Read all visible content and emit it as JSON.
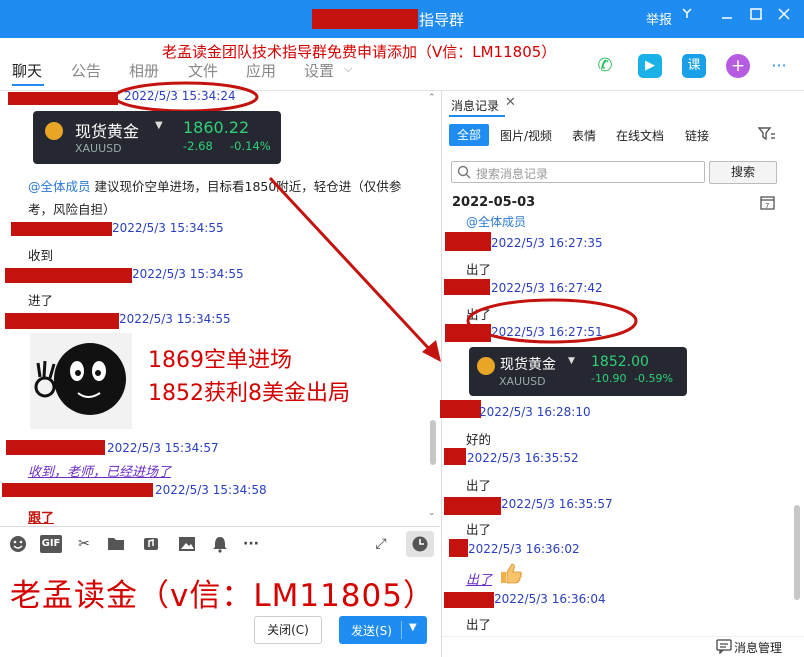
{
  "window": {
    "title": "指导群",
    "report": "举报",
    "promo_banner": "老孟读金团队技术指导群免费申请添加（V信：LM11805）"
  },
  "nav": {
    "tabs": [
      "聊天",
      "公告",
      "相册",
      "文件",
      "应用",
      "设置"
    ]
  },
  "top_icons": {
    "phone": "phone-icon",
    "video": "video-icon",
    "course_label": "课",
    "add": "+",
    "more": "···"
  },
  "chat": {
    "messages": [
      {
        "time": "2022/5/3 15:34:24"
      },
      {
        "time": "2022/5/3 15:34:55",
        "text": "收到"
      },
      {
        "time": "2022/5/3 15:34:55",
        "text": "进了"
      },
      {
        "time": "2022/5/3 15:34:55"
      },
      {
        "time": "2022/5/3 15:34:57",
        "text": "收到，老师，已经进场了"
      },
      {
        "time": "2022/5/3 15:34:58",
        "text": "跟了"
      }
    ],
    "mention": "@全体成员",
    "announcement_line1": "建议现价空单进场，目标看1850附近，轻仓进（仅供参",
    "announcement_line2": "考，风险自担）",
    "gold_card": {
      "name": "现货黄金",
      "symbol": "XAUUSD",
      "price": "1860.22",
      "change": "-2.68",
      "pct": "-0.14%"
    },
    "annotation_line1": "1869空单进场",
    "annotation_line2": "1852获利8美金出局",
    "big_promo": "老孟读金（v信：LM11805）"
  },
  "composer": {
    "close_button": "关闭(C)",
    "send_button": "发送(S)",
    "gif_label": "GIF"
  },
  "history": {
    "title": "消息记录",
    "tabs": [
      "全部",
      "图片/视频",
      "表情",
      "在线文档",
      "链接"
    ],
    "search_placeholder": "搜索消息记录",
    "search_button": "搜索",
    "date": "2022-05-03",
    "mention": "@全体成员",
    "messages": [
      {
        "time": "2022/5/3 16:27:35",
        "text": "出了"
      },
      {
        "time": "2022/5/3 16:27:42",
        "text": "出了"
      },
      {
        "time": "2022/5/3 16:27:51"
      },
      {
        "time": "2022/5/3 16:28:10",
        "text": "好的"
      },
      {
        "time": "2022/5/3 16:35:52",
        "text": "出了"
      },
      {
        "time": "2022/5/3 16:35:57",
        "text": "出了"
      },
      {
        "time": "2022/5/3 16:36:02",
        "text": "出了"
      },
      {
        "time": "2022/5/3 16:36:04",
        "text": "出了"
      }
    ],
    "gold_card": {
      "name": "现货黄金",
      "symbol": "XAUUSD",
      "price": "1852.00",
      "change": "-10.90",
      "pct": "-0.59%"
    },
    "manage_label": "消息管理"
  },
  "colors": {
    "brand_blue": "#1e8cf0",
    "redaction": "#c4120e",
    "annotation_red": "#d40000",
    "timestamp_blue": "#2a3fbf",
    "gold_green": "#2fd07a"
  }
}
